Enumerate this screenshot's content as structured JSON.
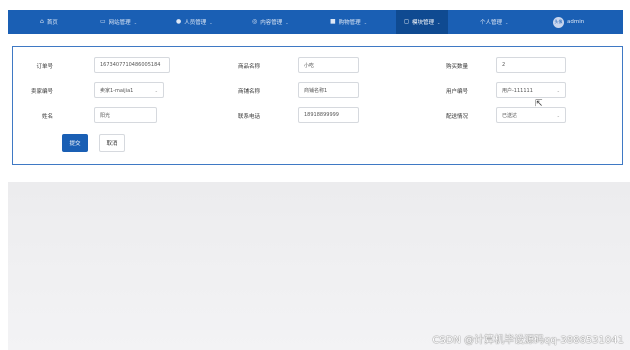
{
  "nav": {
    "items": [
      {
        "label": "首页",
        "icon": "home-icon",
        "glyph": "⌂",
        "caret": false
      },
      {
        "label": "网站管理",
        "icon": "monitor-icon",
        "glyph": "▭",
        "caret": true
      },
      {
        "label": "人员管理",
        "icon": "person-icon",
        "glyph": "●",
        "caret": true
      },
      {
        "label": "内容管理",
        "icon": "content-icon",
        "glyph": "◎",
        "caret": true
      },
      {
        "label": "购物管理",
        "icon": "lock-icon",
        "glyph": "■",
        "caret": true
      },
      {
        "label": "模块管理",
        "icon": "module-icon",
        "glyph": "◻",
        "caret": true,
        "active": true
      },
      {
        "label": "个人管理",
        "icon": "",
        "glyph": "",
        "caret": true
      },
      {
        "label": "admin",
        "icon": "avatar-icon",
        "glyph": "",
        "caret": false
      }
    ],
    "caret_glyph": "⌄",
    "avatar_text": "头像"
  },
  "form": {
    "order_no": {
      "label": "订单号",
      "value": "1673407710486005184"
    },
    "product_name": {
      "label": "商品名称",
      "value": "小吃"
    },
    "quantity": {
      "label": "购买数量",
      "value": "2"
    },
    "seller_no": {
      "label": "卖家编号",
      "value": "卖家1-maijia1"
    },
    "shop_name": {
      "label": "商铺名称",
      "value": "商铺名称1"
    },
    "user_no": {
      "label": "用户编号",
      "value": "用户-111111"
    },
    "name": {
      "label": "姓名",
      "value": "阳光"
    },
    "phone": {
      "label": "联系电话",
      "value": "18918899999"
    },
    "delivery": {
      "label": "配送情况",
      "value": "已送达"
    },
    "submit_label": "提交",
    "cancel_label": "取消"
  },
  "watermark": "CSDN @计算机毕设源码qq-3886531041",
  "colors": {
    "primary": "#1a5fb4",
    "primary_dark": "#0f4a91",
    "border": "#3f79c4"
  }
}
